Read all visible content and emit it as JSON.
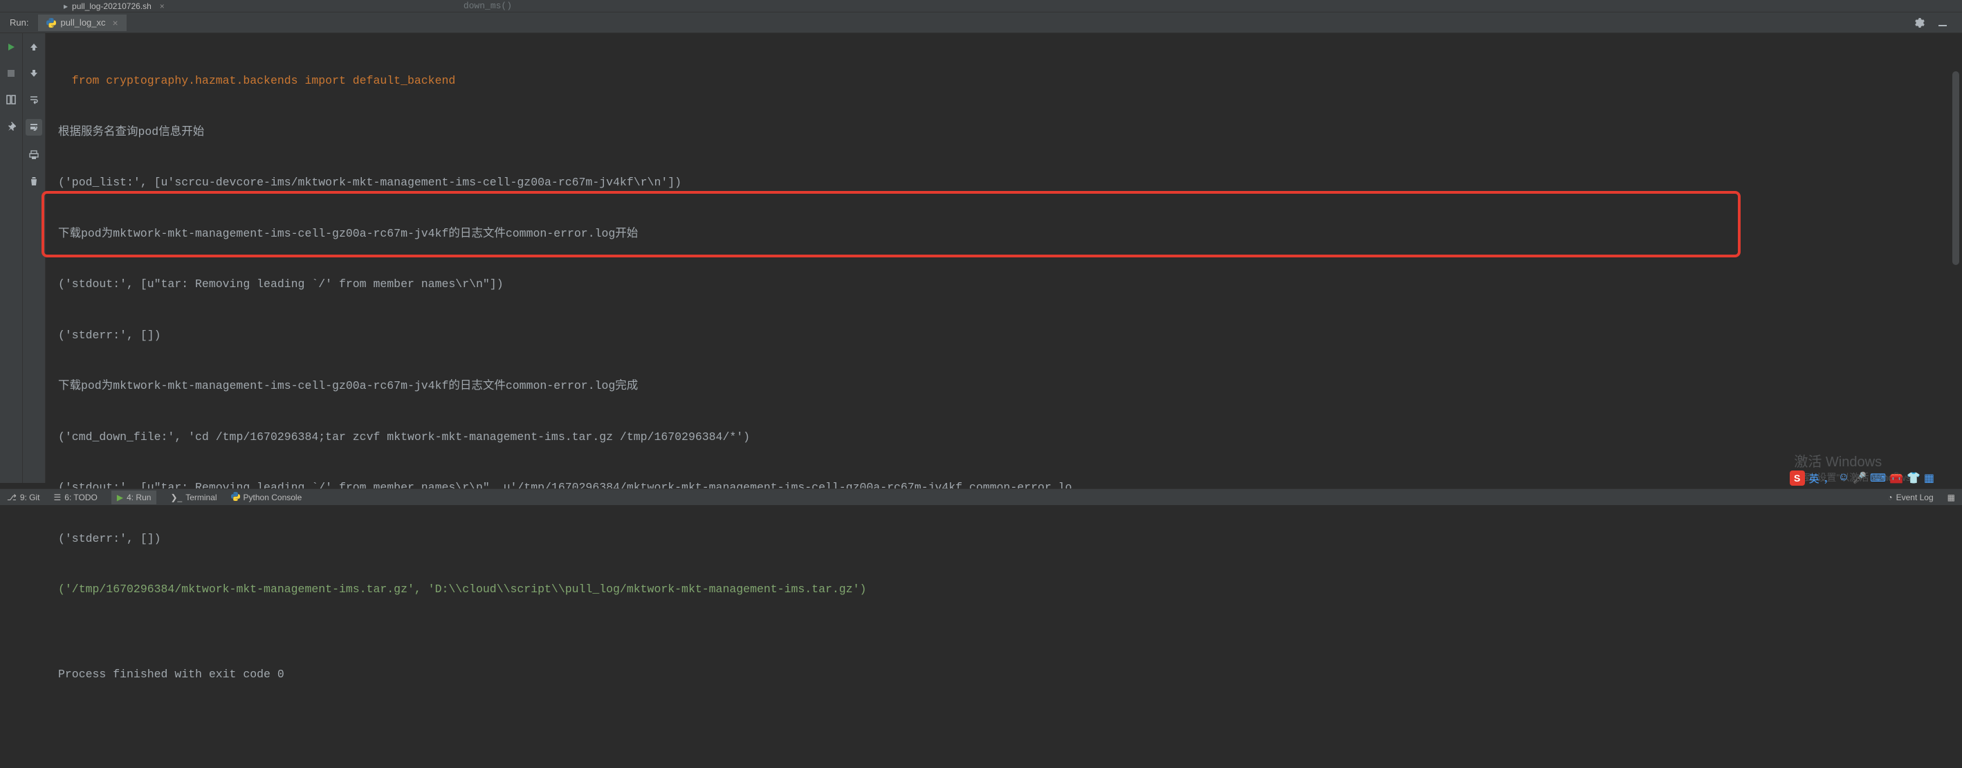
{
  "top_tabs": {
    "file_tab": "pull_log-20210726.sh",
    "partial_text": "down_ms()"
  },
  "run_panel": {
    "label": "Run:",
    "tab_name": "pull_log_xc"
  },
  "console_lines": {
    "l0": "  from cryptography.hazmat.backends import default_backend",
    "l1": "根据服务名查询pod信息开始",
    "l2": "('pod_list:', [u'scrcu-devcore-ims/mktwork-mkt-management-ims-cell-gz00a-rc67m-jv4kf\\r\\n'])",
    "l3": "下载pod为mktwork-mkt-management-ims-cell-gz00a-rc67m-jv4kf的日志文件common-error.log开始",
    "l4": "('stdout:', [u\"tar: Removing leading `/' from member names\\r\\n\"])",
    "l5": "('stderr:', [])",
    "l6": "下载pod为mktwork-mkt-management-ims-cell-gz00a-rc67m-jv4kf的日志文件common-error.log完成",
    "l7": "('cmd_down_file:', 'cd /tmp/1670296384;tar zcvf mktwork-mkt-management-ims.tar.gz /tmp/1670296384/*')",
    "l8": "('stdout:', [u\"tar: Removing leading `/' from member names\\r\\n\", u'/tmp/1670296384/mktwork-mkt-management-ims-cell-gz00a-rc67m-jv4kf_common-error.lo",
    "l9": "('stderr:', [])",
    "l10": "('/tmp/1670296384/mktwork-mkt-management-ims.tar.gz', 'D:\\\\cloud\\\\script\\\\pull_log/mktwork-mkt-management-ims.tar.gz')",
    "l11": "",
    "l12": "Process finished with exit code 0"
  },
  "bottom_bar": {
    "git": "9: Git",
    "todo": "6: TODO",
    "run": "4: Run",
    "terminal": "Terminal",
    "python_console": "Python Console",
    "event_log": "Event Log"
  },
  "watermark": {
    "title": "激活 Windows",
    "subtitle": "转到\"设置\"以激活 Windows。"
  },
  "ime": {
    "zh": "英",
    "sep": "，"
  }
}
